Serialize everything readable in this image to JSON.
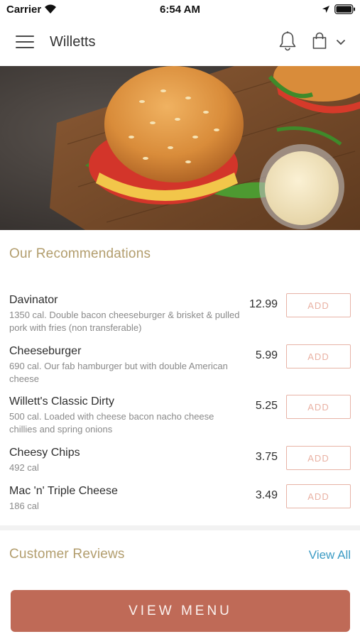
{
  "status_bar": {
    "carrier": "Carrier",
    "time": "6:54 AM"
  },
  "nav": {
    "title": "Willetts",
    "icons": [
      "menu-icon",
      "bell-icon",
      "bag-icon",
      "chevron-down-icon"
    ]
  },
  "hero": {
    "image": "burger-photo"
  },
  "recommendations": {
    "title": "Our Recommendations",
    "add_label": "ADD",
    "items": [
      {
        "name": "Davinator",
        "description": "1350 cal. Double bacon cheeseburger & brisket & pulled pork with fries (non transferable)",
        "price": "12.99"
      },
      {
        "name": "Cheeseburger",
        "description": "690 cal. Our fab hamburger but with double American cheese",
        "price": "5.99"
      },
      {
        "name": "Willett's Classic Dirty",
        "description": "500 cal. Loaded with cheese bacon nacho cheese chillies and spring onions",
        "price": "5.25"
      },
      {
        "name": "Cheesy Chips",
        "description": "492 cal",
        "price": "3.75"
      },
      {
        "name": "Mac 'n' Triple Cheese",
        "description": "186 cal",
        "price": "3.49"
      }
    ]
  },
  "reviews": {
    "title": "Customer Reviews",
    "view_all": "View All"
  },
  "footer": {
    "view_menu": "VIEW MENU"
  },
  "colors": {
    "accent_gold": "#b29d6d",
    "add_button": "#e7b3a6",
    "primary_button": "#bf6a57",
    "link": "#3c9bc4"
  }
}
